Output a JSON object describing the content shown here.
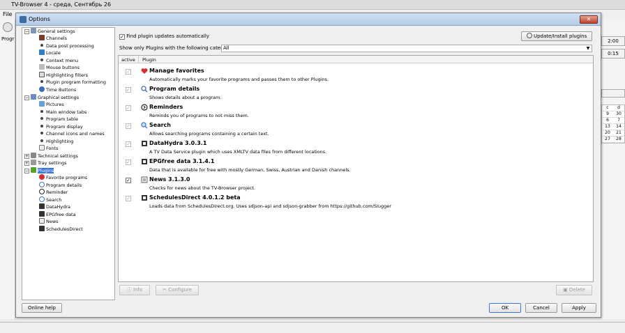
{
  "app": {
    "title": "TV-Browser 4 - среда, Сентябрь 26",
    "menu_file": "File",
    "left_label": "Progr"
  },
  "right_panel": {
    "time1": "2:00",
    "time2": "0:15"
  },
  "calendar": [
    [
      "c",
      "d"
    ],
    [
      "9",
      "30"
    ],
    [
      "6",
      "7"
    ],
    [
      "13",
      "14"
    ],
    [
      "20",
      "21"
    ],
    [
      "27",
      "28"
    ]
  ],
  "dialog": {
    "title": "Options",
    "close": "✕",
    "online_help": "Online help",
    "ok": "OK",
    "cancel": "Cancel",
    "apply": "Apply"
  },
  "tree": {
    "general": "General settings",
    "channels": "Channels",
    "data_post": "Data post processing",
    "locale": "Locale",
    "context_menu": "Context menu",
    "mouse_buttons": "Mouse buttons",
    "highlighting_filters": "Highlighting filters",
    "plugin_formatting": "Plugin program formatting",
    "time_buttons": "Time Buttons",
    "graphical": "Graphical settings",
    "pictures": "Pictures",
    "main_tabs": "Main window tabs",
    "program_table": "Program table",
    "program_display": "Program display",
    "channel_icons": "Channel icons and names",
    "highlighting": "Highlighting",
    "fonts": "Fonts",
    "technical": "Technical settings",
    "tray": "Tray settings",
    "plugins": "Plugins",
    "favorite_programs": "Favorite programs",
    "program_details": "Program details",
    "reminder": "Reminder",
    "search": "Search",
    "datahydra": "DataHydra",
    "epgfree": "EPGfree data",
    "news": "News",
    "schedulesdirect": "SchedulesDirect"
  },
  "plugins_page": {
    "find_updates_label": "Find plugin updates automatically",
    "find_updates_checked": "✓",
    "update_install": "Update/Install plugins",
    "category_label": "Show only Plugins with the following category:",
    "category_value": "All",
    "col_active": "active",
    "col_plugin": "Plugin",
    "info": "Info",
    "configure": "Configure",
    "delete": "Delete"
  },
  "plugins": [
    {
      "name": "Manage favorites",
      "desc": "Automatically marks your favorite programs and passes them to other Plugins.",
      "check": "✓",
      "icon": "heart-icon",
      "color": "#d62b2b"
    },
    {
      "name": "Program details",
      "desc": "Shows details about a program.",
      "check": "✓",
      "icon": "magnifier-icon",
      "color": "#4a6fa8"
    },
    {
      "name": "Reminders",
      "desc": "Reminds you of programs to not miss them.",
      "check": "✓",
      "icon": "reminder-icon",
      "color": "#222222"
    },
    {
      "name": "Search",
      "desc": "Allows searching programs containing a certain text.",
      "check": "✓",
      "icon": "search-icon",
      "color": "#3a7bd5"
    },
    {
      "name": "DataHydra 3.0.3.1",
      "desc": "A TV Data Service plugin which uses XMLTV data files from different locations.",
      "check": "✓",
      "icon": "data-service-icon",
      "color": "#333333"
    },
    {
      "name": "EPGfree data 3.1.4.1",
      "desc": "Data that is available for free with mostly German, Swiss, Austrian and Danish channels.",
      "check": "✓",
      "icon": "data-service-icon",
      "color": "#333333"
    },
    {
      "name": "News 3.1.3.0",
      "desc": "Checks for news about the TV-Browser project.",
      "check": "✓",
      "icon": "news-icon",
      "color": "#666666"
    },
    {
      "name": "SchedulesDirect 4.0.1.2 beta",
      "desc": "Loads data from SchedulesDirect.org. Uses sdjson-api and sdjson-grabber from https://github.com/Slugger",
      "check": "✓",
      "icon": "data-service-icon",
      "color": "#333333"
    }
  ]
}
